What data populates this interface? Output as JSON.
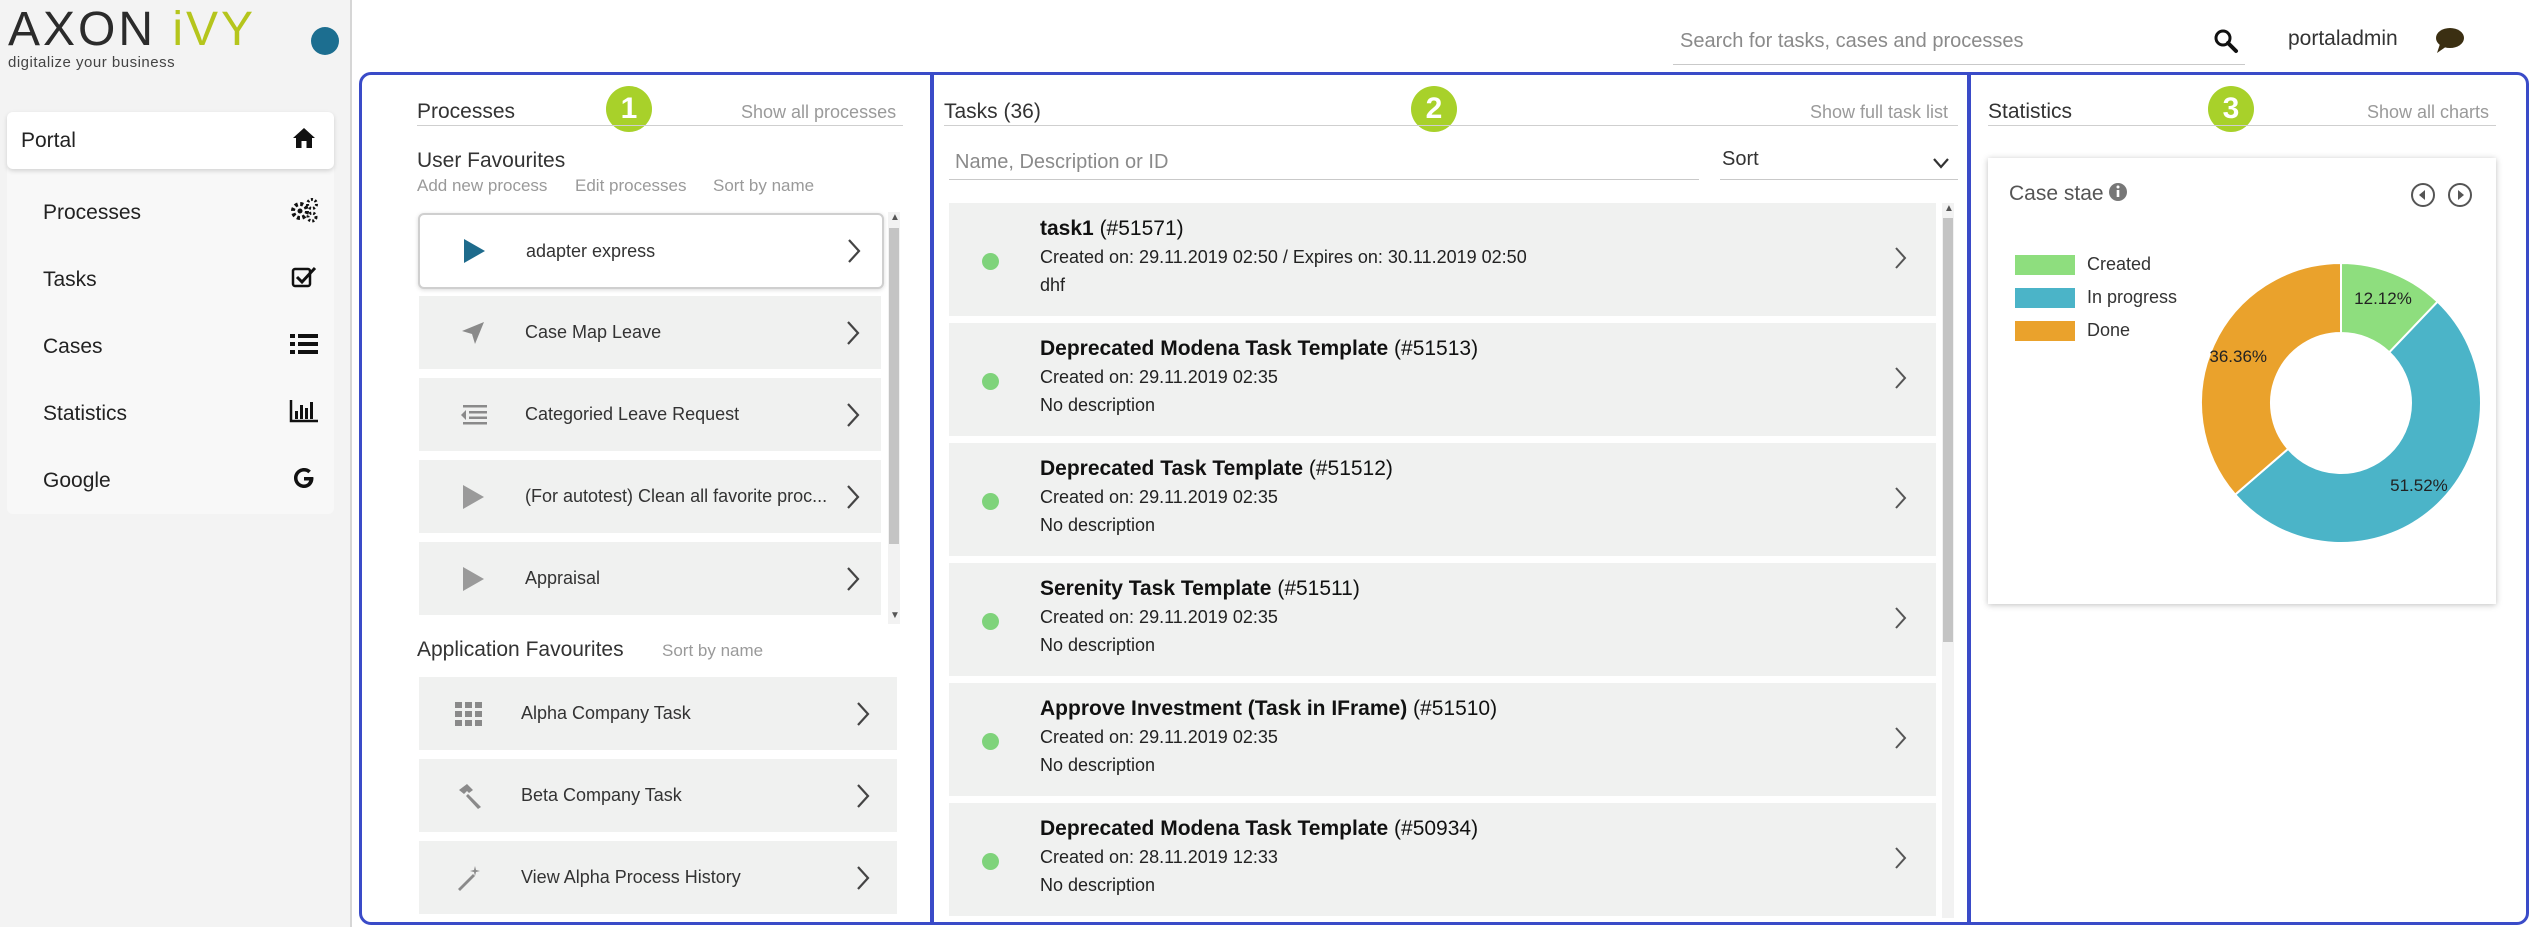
{
  "brand": {
    "logo_main": "AXON",
    "logo_ivy": "iVY",
    "tagline": "digitalize your business"
  },
  "topbar": {
    "search_placeholder": "Search for tasks, cases and processes",
    "username": "portaladmin"
  },
  "nav": {
    "portal": "Portal",
    "items": [
      {
        "label": "Processes",
        "icon": "gears-icon"
      },
      {
        "label": "Tasks",
        "icon": "checkbox-icon"
      },
      {
        "label": "Cases",
        "icon": "list-icon"
      },
      {
        "label": "Statistics",
        "icon": "bar-chart-icon"
      },
      {
        "label": "Google",
        "icon": "google-icon"
      }
    ]
  },
  "badges": [
    "1",
    "2",
    "3"
  ],
  "processes": {
    "title": "Processes",
    "show_all": "Show all processes",
    "user_fav_title": "User Favourites",
    "actions": [
      "Add new process",
      "Edit processes",
      "Sort by name"
    ],
    "items": [
      {
        "label": "adapter express",
        "icon": "play-icon"
      },
      {
        "label": "Case Map Leave",
        "icon": "navigation-arrow-icon"
      },
      {
        "label": "Categoried Leave Request",
        "icon": "text-indent-icon"
      },
      {
        "label": "(For autotest) Clean all favorite proc...",
        "icon": "play-icon"
      },
      {
        "label": "Appraisal",
        "icon": "play-icon"
      }
    ],
    "app_fav_title": "Application Favourites",
    "app_sort": "Sort by name",
    "apps": [
      {
        "label": "Alpha Company Task",
        "icon": "grid-icon"
      },
      {
        "label": "Beta Company Task",
        "icon": "hammer-icon"
      },
      {
        "label": "View Alpha Process History",
        "icon": "magic-wand-icon"
      }
    ]
  },
  "tasks": {
    "title": "Tasks (36)",
    "show_full": "Show full task list",
    "filter_placeholder": "Name, Description or ID",
    "sort_label": "Sort",
    "items": [
      {
        "name": "task1",
        "id": "(#51571)",
        "created": "Created on: 29.11.2019 02:50 / Expires on: 30.11.2019 02:50",
        "desc": "dhf"
      },
      {
        "name": "Deprecated Modena Task Template",
        "id": "(#51513)",
        "created": "Created on: 29.11.2019 02:35",
        "desc": "No description"
      },
      {
        "name": "Deprecated Task Template",
        "id": "(#51512)",
        "created": "Created on: 29.11.2019 02:35",
        "desc": "No description"
      },
      {
        "name": "Serenity Task Template",
        "id": "(#51511)",
        "created": "Created on: 29.11.2019 02:35",
        "desc": "No description"
      },
      {
        "name": "Approve Investment (Task in IFrame)",
        "id": "(#51510)",
        "created": "Created on: 29.11.2019 02:35",
        "desc": "No description"
      },
      {
        "name": "Deprecated Modena Task Template",
        "id": "(#50934)",
        "created": "Created on: 28.11.2019 12:33",
        "desc": "No description"
      }
    ],
    "status_color": "#7fd37b"
  },
  "statistics": {
    "title": "Statistics",
    "show_all": "Show all charts",
    "chart_title": "Case stae"
  },
  "chart_data": {
    "type": "pie",
    "title": "Case stae",
    "donut": true,
    "categories": [
      "Created",
      "In progress",
      "Done"
    ],
    "values": [
      12.12,
      51.52,
      36.36
    ],
    "value_labels": [
      "12.12%",
      "51.52%",
      "36.36%"
    ],
    "colors": [
      "#8ede7e",
      "#4bb4c8",
      "#eaa22c"
    ],
    "legend_position": "left"
  },
  "colors": {
    "accent_border": "#3a4bc8",
    "badge": "#a8d12a",
    "logo_ivy": "#b5c51c"
  }
}
